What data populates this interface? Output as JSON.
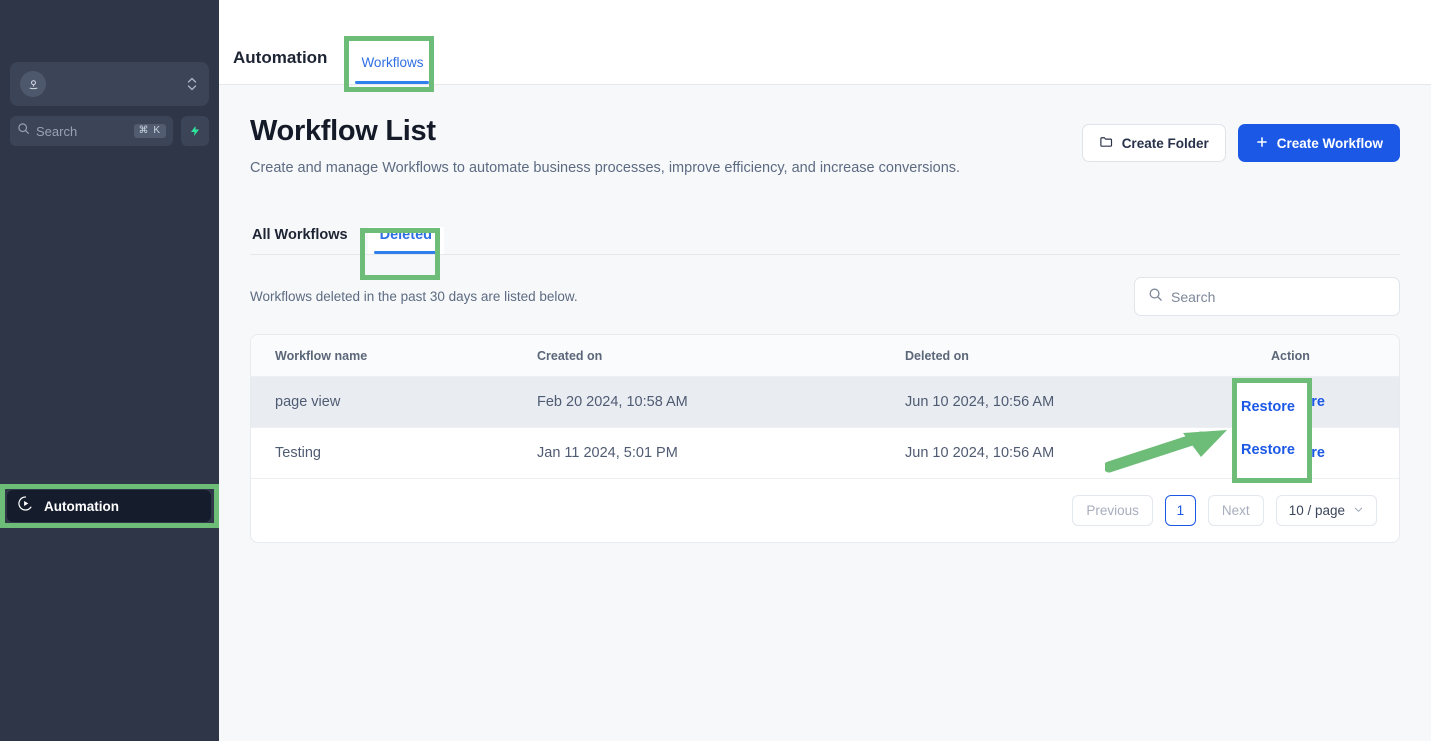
{
  "sidebar": {
    "account": {
      "name": "",
      "avatar_icon": "user-pin-icon",
      "chevrons_icon": "chevron-up-down-icon"
    },
    "search": {
      "placeholder": "Search",
      "icon": "search-icon",
      "shortcut": "⌘ K",
      "spark_icon": "lightning-bolt-icon"
    },
    "nav": {
      "automation_label": "Automation",
      "automation_icon": "play-circle-icon"
    }
  },
  "topbar": {
    "title": "Automation",
    "tabs": [
      {
        "label": "Workflows",
        "active": true
      }
    ]
  },
  "page": {
    "title": "Workflow List",
    "subtitle": "Create and manage Workflows to automate business processes, improve efficiency, and increase conversions.",
    "actions": {
      "create_folder": "Create Folder",
      "create_folder_icon": "folder-icon",
      "create_workflow": "Create Workflow",
      "create_workflow_icon": "plus-icon"
    }
  },
  "subtabs": [
    {
      "label": "All Workflows",
      "active": false
    },
    {
      "label": "Deleted",
      "active": true
    }
  ],
  "filter": {
    "note": "Workflows deleted in the past 30 days are listed below.",
    "search_placeholder": "Search",
    "search_icon": "search-icon"
  },
  "table": {
    "columns": [
      "Workflow name",
      "Created on",
      "Deleted on",
      "Action"
    ],
    "rows": [
      {
        "name": "page view",
        "created_on": "Feb 20 2024, 10:58 AM",
        "deleted_on": "Jun 10 2024, 10:56 AM",
        "action": "Restore"
      },
      {
        "name": "Testing",
        "created_on": "Jan 11 2024, 5:01 PM",
        "deleted_on": "Jun 10 2024, 10:56 AM",
        "action": "Restore"
      }
    ]
  },
  "pagination": {
    "previous": "Previous",
    "page": "1",
    "next": "Next",
    "page_size": "10 / page",
    "page_size_icon": "chevron-down-icon"
  },
  "annotations": {
    "highlight_color": "#6dbd78",
    "targets": [
      "Automation",
      "Workflows",
      "Deleted",
      "Restore"
    ],
    "arrow_icon": "arrow-pointer-icon"
  },
  "colors": {
    "sidebar_bg": "#2e3647",
    "primary": "#1c58e6",
    "tab_active": "#2f80ed",
    "highlight_green": "#6dbd78"
  }
}
